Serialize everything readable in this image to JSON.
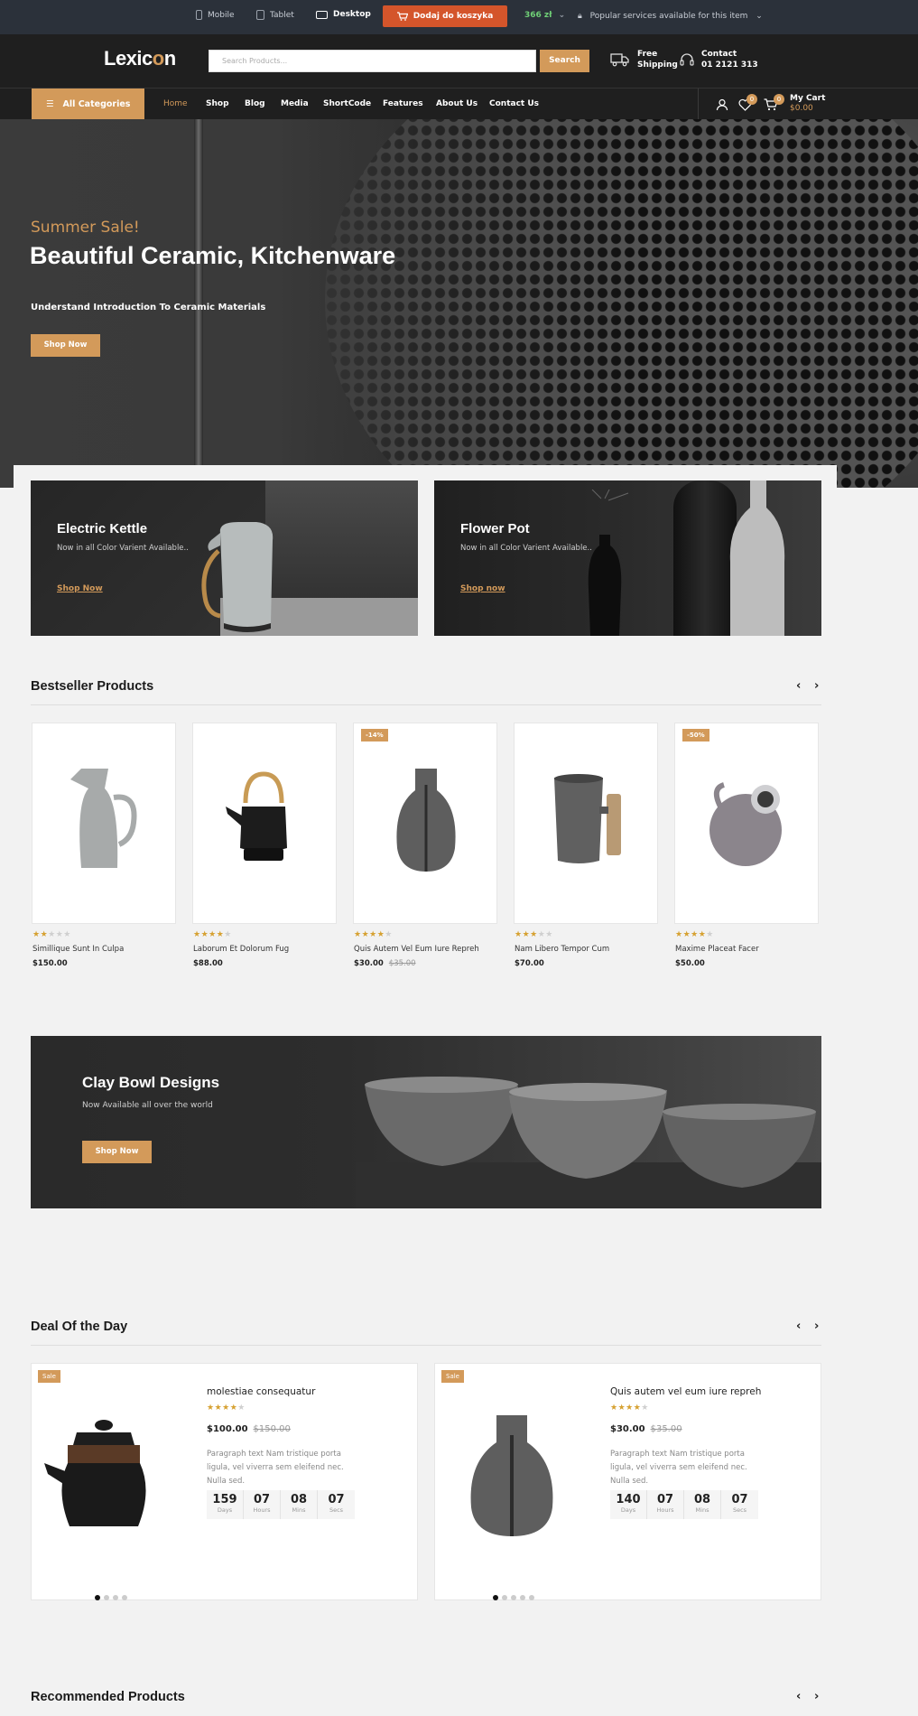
{
  "topbar": {
    "devices": [
      {
        "label": "Mobile",
        "icon": "mobile-icon"
      },
      {
        "label": "Tablet",
        "icon": "tablet-icon"
      },
      {
        "label": "Desktop",
        "icon": "desktop-icon"
      }
    ],
    "cart_button": "Dodaj do koszyka",
    "price": "366 zł",
    "popular": "Popular services available for this item"
  },
  "header": {
    "logo_pre": "Lexic",
    "logo_accent": "o",
    "logo_post": "n",
    "search_placeholder": "Search Products...",
    "search_button": "Search",
    "shipping_line1": "Free",
    "shipping_line2": "Shipping",
    "contact_line1": "Contact",
    "contact_line2": "01 2121 313"
  },
  "nav": {
    "all_categories": "All Categories",
    "links": [
      "Home",
      "Shop",
      "Blog",
      "Media",
      "ShortCode",
      "Features",
      "About Us",
      "Contact Us"
    ],
    "wishlist_count": "0",
    "cart_count": "0",
    "cart_label": "My Cart",
    "cart_total": "$0.00"
  },
  "hero": {
    "subtitle": "Summer Sale!",
    "title": "Beautiful Ceramic, Kitchenware",
    "text": "Understand Introduction To Ceramic Materials",
    "button": "Shop Now"
  },
  "promos": [
    {
      "title": "Electric Kettle",
      "subtitle": "Now in all Color Varient Available..",
      "link": "Shop Now"
    },
    {
      "title": "Flower Pot",
      "subtitle": "Now in all Color Varient Available..",
      "link": "Shop now"
    }
  ],
  "bestseller": {
    "title": "Bestseller Products",
    "products": [
      {
        "name": "Simillique Sunt In Culpa",
        "price": "$150.00",
        "old_price": "",
        "rating": 2,
        "discount": ""
      },
      {
        "name": "Laborum Et Dolorum Fug",
        "price": "$88.00",
        "old_price": "",
        "rating": 4,
        "discount": ""
      },
      {
        "name": "Quis Autem Vel Eum Iure Repreh",
        "price": "$30.00",
        "old_price": "$35.00",
        "rating": 4,
        "discount": "-14%"
      },
      {
        "name": "Nam Libero Tempor Cum",
        "price": "$70.00",
        "old_price": "",
        "rating": 3,
        "discount": ""
      },
      {
        "name": "Maxime Placeat Facer",
        "price": "$50.00",
        "old_price": "",
        "rating": 4,
        "discount": "-50%"
      }
    ]
  },
  "clay": {
    "title": "Clay Bowl Designs",
    "subtitle": "Now Available all over the world",
    "button": "Shop Now"
  },
  "deal": {
    "title": "Deal Of the Day",
    "items": [
      {
        "badge": "Sale",
        "name": "molestiae consequatur",
        "price": "$100.00",
        "old_price": "$150.00",
        "rating": 4,
        "desc": "Paragraph text Nam tristique porta ligula, vel viverra sem eleifend nec. Nulla sed.",
        "countdown": [
          {
            "n": "159",
            "l": "Days"
          },
          {
            "n": "07",
            "l": "Hours"
          },
          {
            "n": "08",
            "l": "Mins"
          },
          {
            "n": "07",
            "l": "Secs"
          }
        ]
      },
      {
        "badge": "Sale",
        "name": "Quis autem vel eum iure repreh",
        "price": "$30.00",
        "old_price": "$35.00",
        "rating": 4,
        "desc": "Paragraph text Nam tristique porta ligula, vel viverra sem eleifend nec. Nulla sed.",
        "countdown": [
          {
            "n": "140",
            "l": "Days"
          },
          {
            "n": "07",
            "l": "Hours"
          },
          {
            "n": "08",
            "l": "Mins"
          },
          {
            "n": "07",
            "l": "Secs"
          }
        ]
      }
    ]
  },
  "recommended": {
    "title": "Recommended Products"
  },
  "colors": {
    "accent": "#d39a5a",
    "dark": "#1f1f1f",
    "topbar": "#2b313a",
    "cart_button": "#d4552b"
  }
}
